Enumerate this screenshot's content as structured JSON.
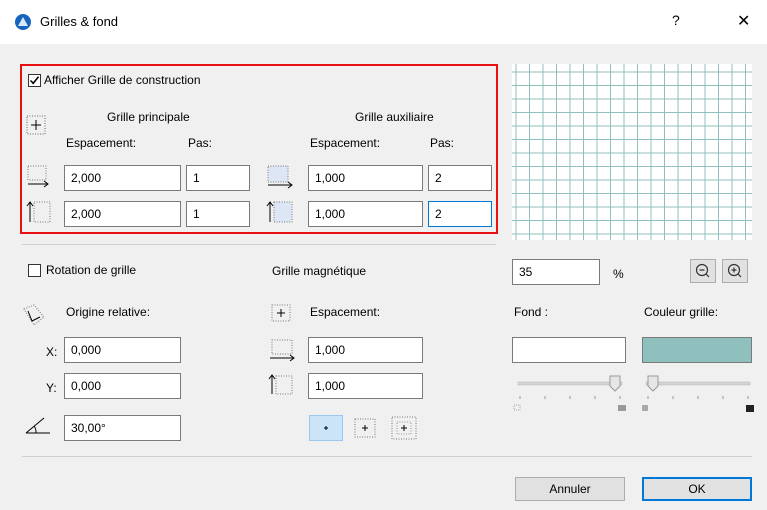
{
  "window": {
    "title": "Grilles & fond",
    "help_glyph": "?",
    "close_glyph": "✕",
    "icon": "archicad-logo-icon"
  },
  "construction_grid": {
    "show_label": "Afficher Grille de construction",
    "show_checked": true,
    "main": {
      "title": "Grille principale",
      "spacing_header": "Espacement:",
      "step_header": "Pas:",
      "horizontal_spacing": "2,000",
      "horizontal_step": "1",
      "vertical_spacing": "2,000",
      "vertical_step": "1"
    },
    "aux": {
      "title": "Grille auxiliaire",
      "spacing_header": "Espacement:",
      "step_header": "Pas:",
      "horizontal_spacing": "1,000",
      "horizontal_step": "2",
      "vertical_spacing": "1,000",
      "vertical_step": "2"
    }
  },
  "rotation": {
    "label": "Rotation de grille",
    "checked": false,
    "origin_label": "Origine relative:",
    "x_label": "X:",
    "x_value": "0,000",
    "y_label": "Y:",
    "y_value": "0,000",
    "angle_value": "30,00°"
  },
  "snap_grid": {
    "title": "Grille magnétique",
    "spacing_label": "Espacement:",
    "horizontal_value": "1,000",
    "vertical_value": "1,000"
  },
  "preview": {
    "zoom_value": "35",
    "zoom_unit": "%",
    "zoom_out_icon": "zoom-out-icon",
    "zoom_in_icon": "zoom-in-icon",
    "background_label": "Fond :",
    "grid_color_label": "Couleur grille:",
    "background_color": "#ffffff",
    "grid_color": "#8fc0bd"
  },
  "buttons": {
    "cancel": "Annuler",
    "ok": "OK"
  }
}
